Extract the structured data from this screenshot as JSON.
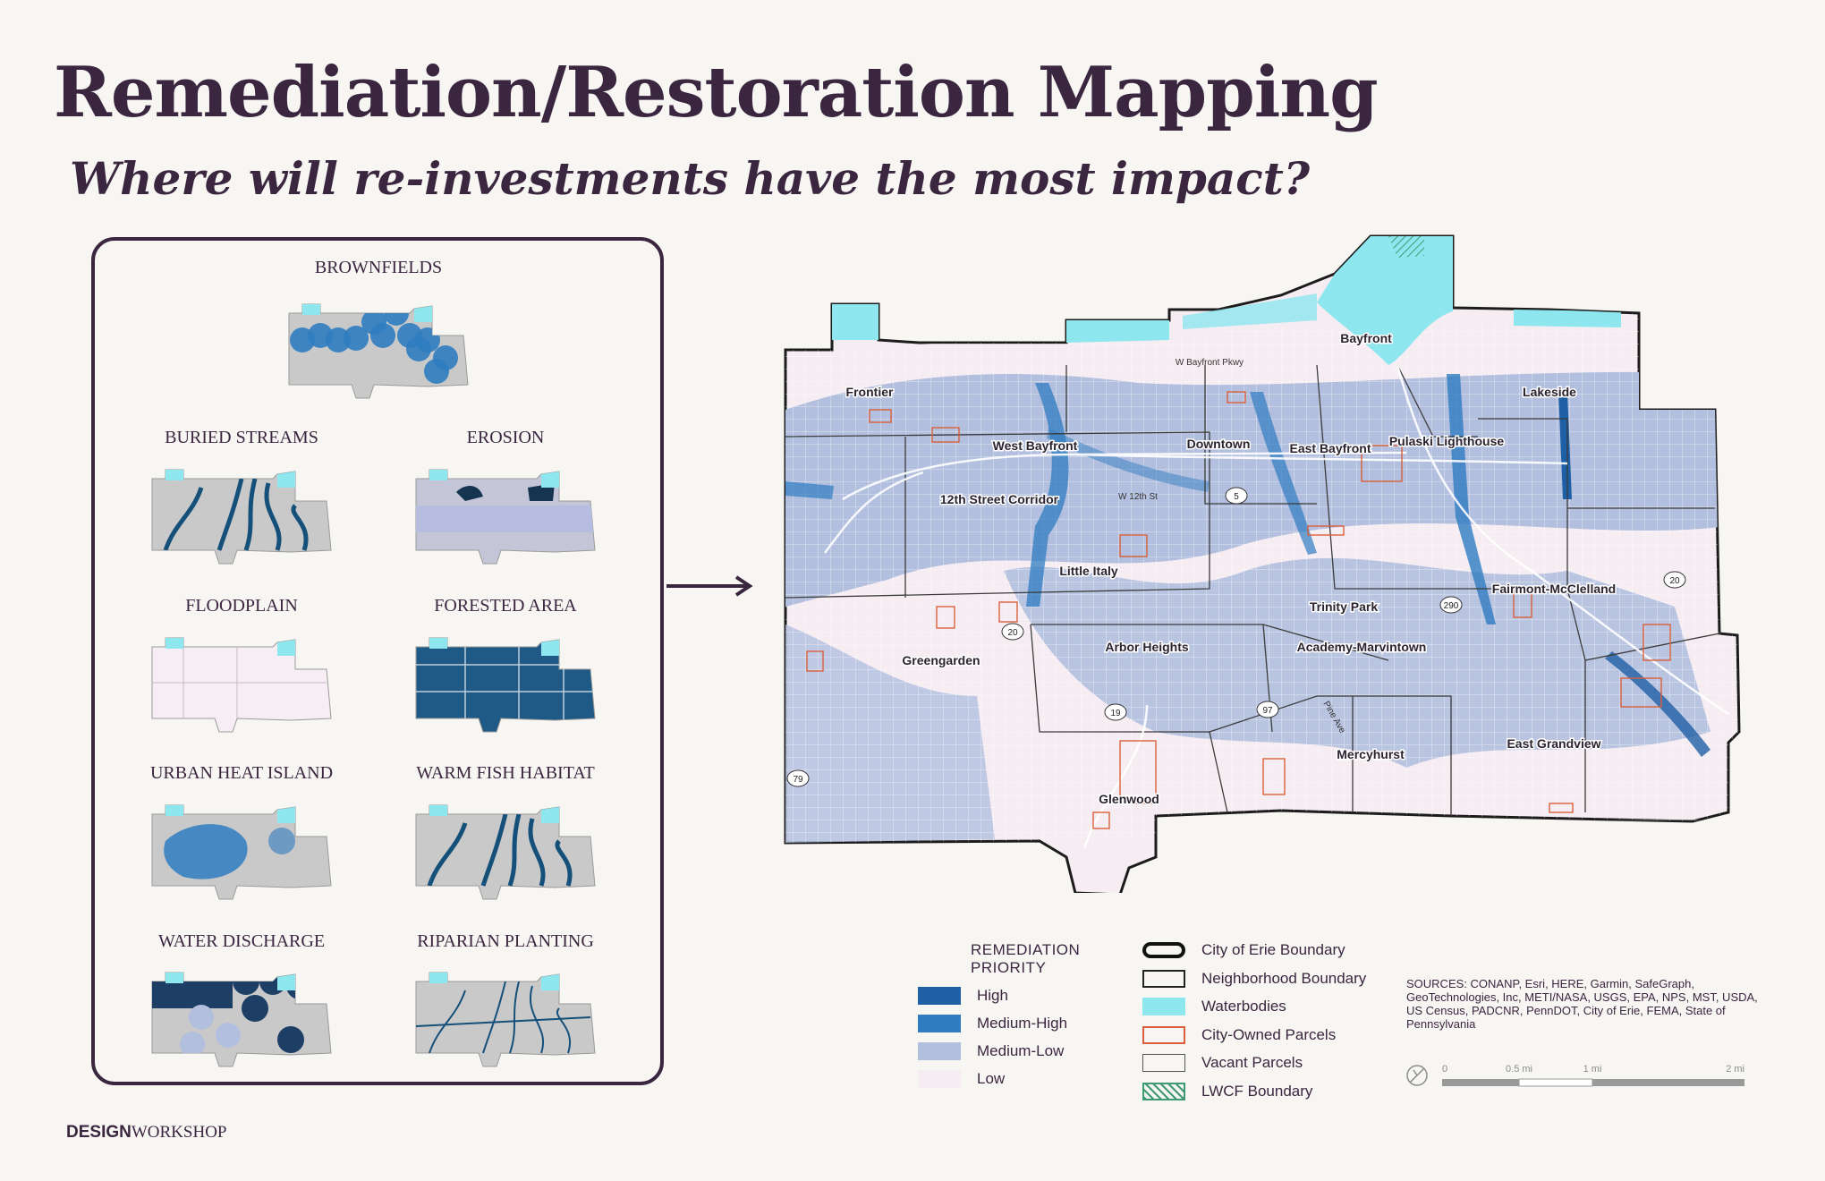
{
  "header": {
    "title": "Remediation/Restoration Mapping",
    "subtitle": "Where will re-investments have the most impact?"
  },
  "layers": [
    {
      "label": "BROWNFIELDS",
      "style": "brownfields"
    },
    {
      "label": "BURIED STREAMS",
      "style": "streams"
    },
    {
      "label": "EROSION",
      "style": "erosion"
    },
    {
      "label": "FLOODPLAIN",
      "style": "floodplain"
    },
    {
      "label": "FORESTED AREA",
      "style": "forest"
    },
    {
      "label": "URBAN HEAT ISLAND",
      "style": "heat"
    },
    {
      "label": "WARM FISH HABITAT",
      "style": "streams"
    },
    {
      "label": "WATER DISCHARGE",
      "style": "discharge"
    },
    {
      "label": "RIPARIAN PLANTING",
      "style": "riparian"
    }
  ],
  "map": {
    "neighborhoods": [
      "Bayfront",
      "Frontier",
      "Lakeside",
      "West Bayfront",
      "Downtown",
      "East Bayfront",
      "Pulaski Lighthouse",
      "12th Street Corridor",
      "Little Italy",
      "Trinity Park",
      "Fairmont-McClelland",
      "Greengarden",
      "Arbor Heights",
      "Academy-Marvintown",
      "Mercyhurst",
      "East Grandview",
      "Glenwood"
    ],
    "road_labels": [
      "W Bayfront Pkwy",
      "W 12th St",
      "Pine Ave"
    ],
    "route_shields": [
      "5",
      "20",
      "290",
      "20",
      "19",
      "97",
      "79"
    ]
  },
  "legend": {
    "priority_title": "REMEDIATION PRIORITY",
    "priority": [
      {
        "label": "High",
        "color": "#1f5fa6"
      },
      {
        "label": "Medium-High",
        "color": "#2f7cc0"
      },
      {
        "label": "Medium-Low",
        "color": "#b3bfdf"
      },
      {
        "label": "Low",
        "color": "#f6edf3"
      }
    ],
    "boundaries": [
      {
        "label": "City of Erie Boundary",
        "style": "city"
      },
      {
        "label": "Neighborhood Boundary",
        "style": "neigh"
      },
      {
        "label": "Waterbodies",
        "style": "water"
      },
      {
        "label": "City-Owned Parcels",
        "style": "city-owned"
      },
      {
        "label": "Vacant Parcels",
        "style": "vacant"
      },
      {
        "label": "LWCF Boundary",
        "style": "lwcf"
      }
    ]
  },
  "sources": "SOURCES: CONANP, Esri, HERE, Garmin, SafeGraph, GeoTechnologies, Inc, METI/NASA, USGS, EPA, NPS, MST, USDA, US Census, PADCNR, PennDOT, City of Erie, FEMA, State of Pennsylvania",
  "scale": {
    "ticks": [
      "0",
      "0.5 mi",
      "1 mi",
      "2 mi"
    ]
  },
  "logo": {
    "bold": "DESIGN",
    "light": "WORKSHOP"
  },
  "colors": {
    "ink": "#3b2640",
    "water": "#8ee6ef",
    "high": "#1f5fa6",
    "medium_high": "#2f7cc0",
    "medium_low": "#b3bfdf",
    "low": "#f6edf3",
    "parcel": "#d9603b"
  }
}
